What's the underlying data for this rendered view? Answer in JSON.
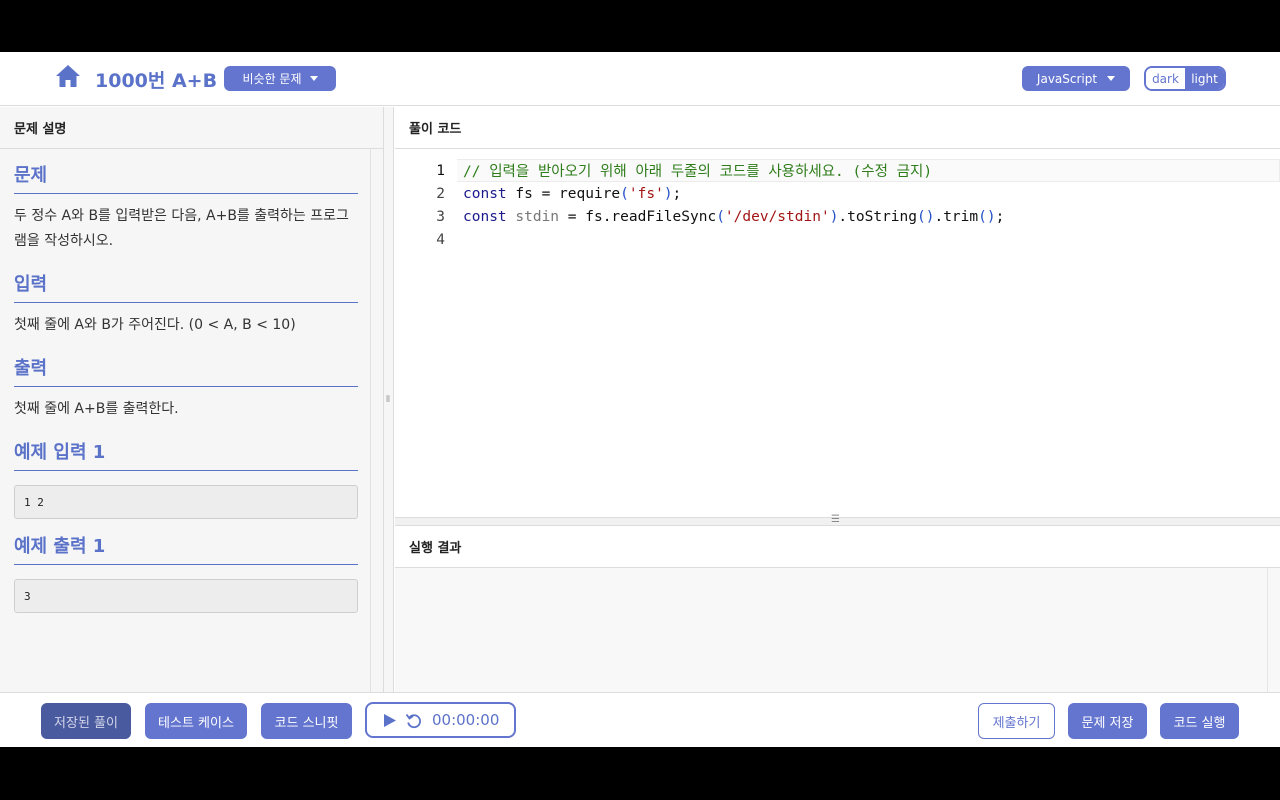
{
  "header": {
    "title": "1000번 A+B",
    "similar_label": "비슷한 문제",
    "language": "JavaScript",
    "theme_dark": "dark",
    "theme_light": "light"
  },
  "left_panel": {
    "heading": "문제 설명",
    "problem_title": "문제",
    "problem_text": "두 정수 A와 B를 입력받은 다음, A+B를 출력하는 프로그램을 작성하시오.",
    "input_title": "입력",
    "input_text": "첫째 줄에 A와 B가 주어진다. (0 < A, B < 10)",
    "output_title": "출력",
    "output_text": "첫째 줄에 A+B를 출력한다.",
    "sample_input_title": "예제 입력 1",
    "sample_input": "1 2",
    "sample_output_title": "예제 출력 1",
    "sample_output": "3"
  },
  "code_panel": {
    "heading": "풀이 코드",
    "line_numbers": [
      "1",
      "2",
      "3",
      "4"
    ],
    "line1_comment": "// 입력을 받아오기 위해 아래 두줄의 코드를 사용하세요. (수정 금지)",
    "line2": {
      "kw": "const",
      "name": " fs = ",
      "fn": "require",
      "open": "(",
      "str": "'fs'",
      "close": ")",
      "end": ";"
    },
    "line3": {
      "kw": "const",
      "var": " stdin",
      "eq": " = fs.readFileSync",
      "open": "(",
      "str": "'/dev/stdin'",
      "close": ")",
      "m1": ".toString",
      "p1": "()",
      "m2": ".trim",
      "p2": "()",
      "end": ";"
    }
  },
  "result_panel": {
    "heading": "실행 결과"
  },
  "footer": {
    "saved_label": "저장된 풀이",
    "test_label": "테스트 케이스",
    "snippet_label": "코드 스니핏",
    "timer": "00:00:00",
    "submit_label": "제출하기",
    "save_label": "문제 저장",
    "run_label": "코드 실행"
  },
  "colors": {
    "accent": "#6475cf",
    "heading": "#5b72c9"
  },
  "icons": [
    "home-icon",
    "caret-down-icon",
    "play-icon",
    "reset-icon"
  ]
}
